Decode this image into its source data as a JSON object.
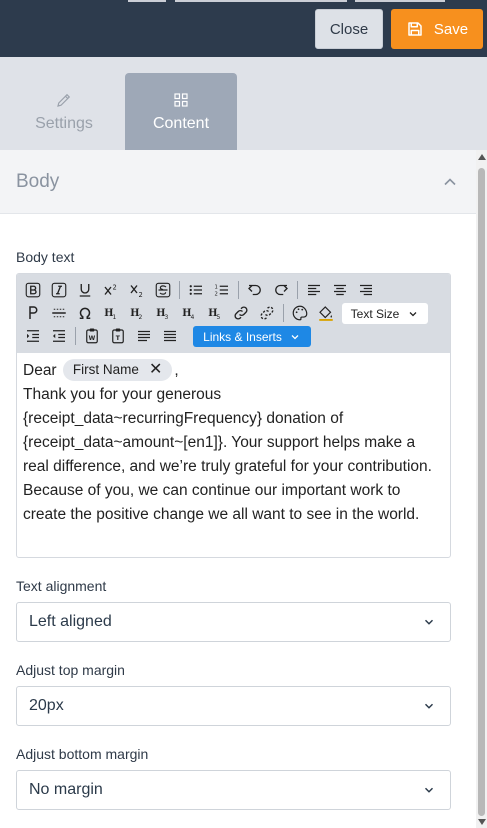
{
  "header": {
    "close_label": "Close",
    "save_label": "Save"
  },
  "tabs": [
    {
      "label": "Settings",
      "icon": "pencil-icon",
      "active": false
    },
    {
      "label": "Content",
      "icon": "grid-icon",
      "active": true
    }
  ],
  "section": {
    "title": "Body"
  },
  "body_text": {
    "label": "Body text",
    "toolbar": {
      "text_size_label": "Text Size",
      "links_label": "Links & Inserts"
    },
    "content": {
      "greeting": "Dear",
      "merge_tag": "First Name",
      "after_tag": ",",
      "paragraph1": "Thank you for your generous {receipt_data~recurringFrequency} donation of {receipt_data~amount~[en1]}. Your support helps make a real difference, and we’re truly grateful for your contribution.",
      "paragraph2": "Because of you, we can continue our important work to create the positive change we all want to see in the world."
    }
  },
  "text_alignment": {
    "label": "Text alignment",
    "value": "Left aligned"
  },
  "top_margin": {
    "label": "Adjust top margin",
    "value": "20px"
  },
  "bottom_margin": {
    "label": "Adjust bottom margin",
    "value": "No margin"
  },
  "colors": {
    "topbar": "#2d3b4d",
    "save": "#f7901e",
    "active_tab": "#9ea8b7",
    "links_button": "#1e88e5"
  }
}
